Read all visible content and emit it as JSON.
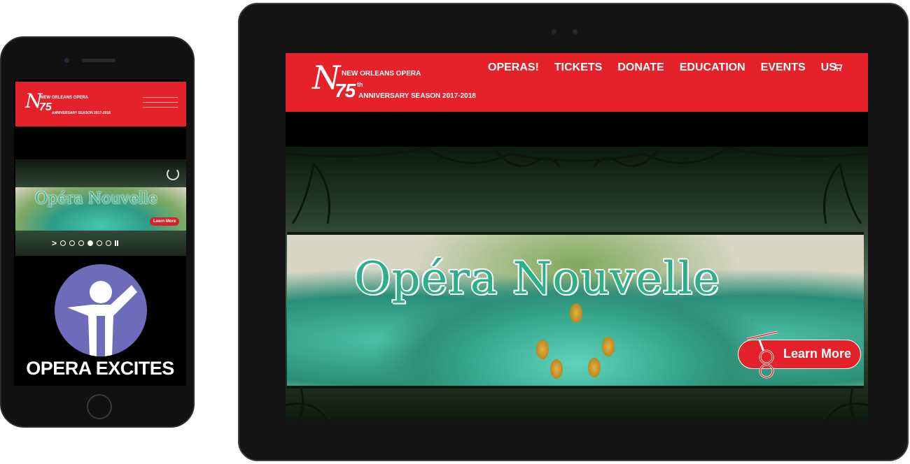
{
  "site": {
    "logo": {
      "org": "NEW ORLEANS OPERA",
      "number": "75",
      "ordinal": "th",
      "season": "ANNIVERSARY SEASON 2017-2018"
    },
    "nav": [
      "OPERAS!",
      "TICKETS",
      "DONATE",
      "EDUCATION",
      "EVENTS",
      "US"
    ],
    "cart_icon": "cart-icon",
    "slide": {
      "title": "Opéra Nouvelle",
      "cta": "Learn More"
    },
    "slider": {
      "next_arrow": ">",
      "dot_count": 6,
      "active_dot": 4
    },
    "feature": {
      "label": "OPERA EXCITES",
      "icon": "person-cheering-icon"
    }
  },
  "colors": {
    "brand_red": "#e52229",
    "feature_purple": "#6d6cbb",
    "teal_text": "#2fae8a"
  }
}
